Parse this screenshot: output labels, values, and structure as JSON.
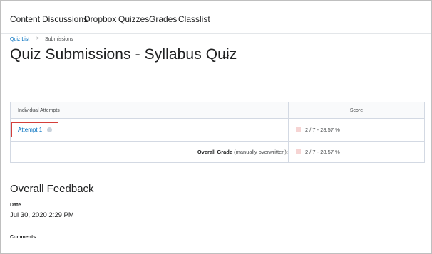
{
  "nav": {
    "items": [
      {
        "label": "Content"
      },
      {
        "label": "Discussions"
      },
      {
        "label": "Dropbox"
      },
      {
        "label": "Quizzes"
      },
      {
        "label": "Grades"
      },
      {
        "label": "Classlist"
      }
    ]
  },
  "breadcrumb": {
    "link": "Quiz List",
    "separator": ">",
    "current": "Submissions"
  },
  "page": {
    "title": "Quiz Submissions - Syllabus Quiz"
  },
  "attempts_table": {
    "headers": {
      "attempts": "Individual Attempts",
      "score": "Score"
    },
    "rows": [
      {
        "label": "Attempt 1",
        "score": "2 / 7 - 28.57 %"
      }
    ],
    "overall": {
      "label_bold": "Overall Grade",
      "label_rest": " (manually overwritten):",
      "score": "2 / 7 - 28.57 %"
    }
  },
  "feedback": {
    "heading": "Overall Feedback",
    "date_label": "Date",
    "date_value": "Jul 30, 2020 2:29 PM",
    "comments_label": "Comments"
  },
  "colors": {
    "link": "#006fbf",
    "highlight_border": "#d43f3a",
    "score_swatch": "#f6d4d3"
  }
}
